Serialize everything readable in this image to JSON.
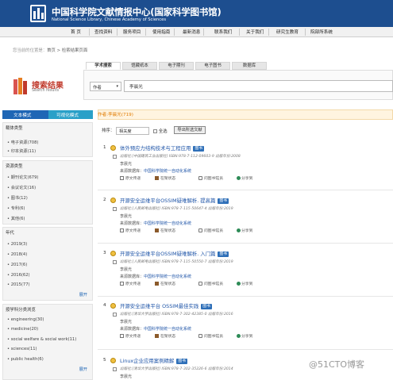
{
  "header": {
    "title": "中国科学院文献情报中心(国家科学图书馆)",
    "subtitle": "National Science Library, Chinese Academy of Sciences"
  },
  "nav": {
    "items": [
      "首 页",
      "查找资料",
      "服务项目",
      "使用指南",
      "最新消息",
      "联系我们",
      "关于我们",
      "研究生教育",
      "院部所系统"
    ]
  },
  "breadcrumb": {
    "prefix": "您当前的位置是：",
    "path": "首页 > 检索结果页面"
  },
  "search": {
    "tabs": [
      "学术搜索",
      "馆藏纸本",
      "电子期刊",
      "电子图书",
      "数据库"
    ],
    "heading": "搜索结果",
    "heading_en": "Search results",
    "field": "作者",
    "query": "李晨光"
  },
  "sidebar": {
    "modes": [
      "文本模式",
      "可视化模式"
    ],
    "sections": [
      {
        "title": "载体类型",
        "items": [
          "• 电子资源(708)",
          "• 印本资源(11)"
        ],
        "more": ""
      },
      {
        "title": "资源类型",
        "items": [
          "• 期刊论文(679)",
          "• 会议论文(16)",
          "• 图书(12)",
          "• 专利(6)",
          "• 其他(6)"
        ],
        "more": ""
      },
      {
        "title": "年代",
        "items": [
          "• 2019(3)",
          "• 2018(4)",
          "• 2017(6)",
          "• 2016(62)",
          "• 2015(77)"
        ],
        "more": "展开"
      },
      {
        "title": "按学科分类浏览",
        "items": [
          "• engineering(30)",
          "• medicine(20)",
          "• social welfare & social work(11)",
          "• sciences(11)",
          "• public health(6)"
        ],
        "more": "展开"
      }
    ]
  },
  "results": {
    "summary": "作者:李晨光(719)",
    "sort_label": "排序：",
    "sort_value": "相关度",
    "select_all": "全选",
    "export": "导出所选文献",
    "items": [
      {
        "num": "1",
        "title": "体外预应力结构技术与工程应用",
        "badge": "图书",
        "meta": "出版社:[中国建筑工业出版社] ISBN:978-7-112-09603-9 出版年份:2008",
        "author": "李晨光",
        "source_label": "来源数据库：",
        "source": "中国科学院统一自动化系统",
        "actions": [
          "原文传递",
          "在架状态",
          "问图书馆员",
          "分享到"
        ]
      },
      {
        "num": "2",
        "title": "开源安全运维平台OSSIM疑难解析. 提高篇",
        "badge": "图书",
        "meta": "出版社:[人民邮电出版社] ISBN:978-7-115-50647-4 出版年份:2019",
        "author": "李晨光",
        "source_label": "来源数据库：",
        "source": "中国科学院统一自动化系统",
        "actions": [
          "原文传递",
          "在架状态",
          "问图书馆员",
          "分享到"
        ]
      },
      {
        "num": "3",
        "title": "开源安全运维平台OSSIM疑难解析. 入门篇",
        "badge": "图书",
        "meta": "出版社:[人民邮电出版社] ISBN:978-7-115-50550-7 出版年份:2019",
        "author": "李晨光",
        "source_label": "来源数据库：",
        "source": "中国科学院统一自动化系统",
        "actions": [
          "原文传递",
          "在架状态",
          "问图书馆员",
          "分享到"
        ]
      },
      {
        "num": "4",
        "title": "开源安全运维平台 OSSIM最佳实践",
        "badge": "图书",
        "meta": "出版社:[清华大学出版社] ISBN:978-7-302-42385-0 出版年份:2016",
        "author": "李晨光",
        "source_label": "来源数据库：",
        "source": "中国科学院统一自动化系统",
        "actions": [
          "原文传递",
          "在架状态",
          "问图书馆员",
          "分享到"
        ]
      },
      {
        "num": "5",
        "title": "Linux企业应用案例精解",
        "badge": "图书",
        "meta": "出版社:[清华大学出版社] ISBN:978-7-302-35226-6 出版年份:2014",
        "author": "李晨光",
        "source_label": "",
        "source": "",
        "actions": []
      }
    ]
  },
  "watermark": "@51CTO博客",
  "colors": {
    "header_bg": "#1d4e8f",
    "accent_blue": "#1f66b5",
    "link_blue": "#1f55a8",
    "orange": "#e07b00"
  }
}
